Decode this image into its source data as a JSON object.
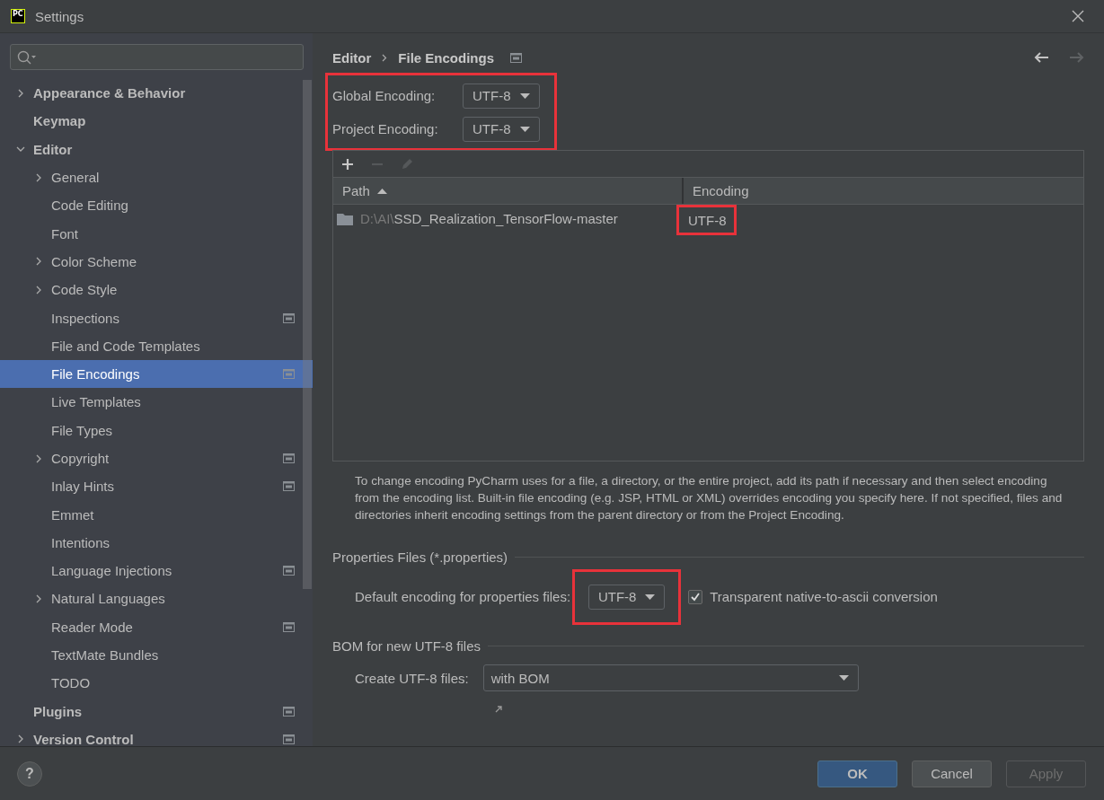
{
  "window": {
    "title": "Settings",
    "logo_text": "PC"
  },
  "sidebar": {
    "items": [
      {
        "label": "Appearance & Behavior",
        "expanded": false,
        "selected": false
      },
      {
        "label": "Keymap",
        "selected": false
      },
      {
        "label": "Editor",
        "expanded": true,
        "selected": false,
        "children": [
          {
            "label": "General",
            "expanded": false,
            "selected": false
          },
          {
            "label": "Code Editing",
            "selected": false
          },
          {
            "label": "Font",
            "selected": false
          },
          {
            "label": "Color Scheme",
            "expanded": false,
            "selected": false
          },
          {
            "label": "Code Style",
            "expanded": false,
            "selected": false
          },
          {
            "label": "Inspections",
            "selected": false,
            "project_scoped": true
          },
          {
            "label": "File and Code Templates",
            "selected": false
          },
          {
            "label": "File Encodings",
            "selected": true,
            "project_scoped": true
          },
          {
            "label": "Live Templates",
            "selected": false
          },
          {
            "label": "File Types",
            "selected": false
          },
          {
            "label": "Copyright",
            "expanded": false,
            "selected": false,
            "project_scoped": true
          },
          {
            "label": "Inlay Hints",
            "selected": false,
            "project_scoped": true
          },
          {
            "label": "Emmet",
            "selected": false
          },
          {
            "label": "Intentions",
            "selected": false
          },
          {
            "label": "Language Injections",
            "selected": false,
            "project_scoped": true
          },
          {
            "label": "Natural Languages",
            "expanded": false,
            "selected": false
          },
          {
            "label": "Reader Mode",
            "selected": false,
            "project_scoped": true
          },
          {
            "label": "TextMate Bundles",
            "selected": false
          },
          {
            "label": "TODO",
            "selected": false
          }
        ]
      },
      {
        "label": "Plugins",
        "selected": false,
        "project_scoped": true
      },
      {
        "label": "Version Control",
        "expanded": false,
        "selected": false,
        "project_scoped": true
      }
    ]
  },
  "header": {
    "breadcrumb": [
      "Editor",
      "File Encodings"
    ],
    "project_scoped": true,
    "navigation": [
      {
        "kind": "back",
        "disabled": false
      },
      {
        "kind": "forward",
        "disabled": true
      }
    ]
  },
  "encodings": {
    "highlighted": true,
    "fields": [
      {
        "label": "Global Encoding:",
        "value": "UTF-8"
      },
      {
        "label": "Project Encoding:",
        "value": "UTF-8"
      }
    ]
  },
  "table": {
    "toolbar": [
      {
        "kind": "add",
        "disabled": false
      },
      {
        "kind": "remove",
        "disabled": true
      },
      {
        "kind": "edit",
        "disabled": true
      }
    ],
    "columns": [
      {
        "label": "Path",
        "sort_ascending": true
      },
      {
        "label": "Encoding"
      }
    ],
    "rows": [
      {
        "path_prefix": "D:\\AI\\",
        "path": "SSD_Realization_TensorFlow-master",
        "encoding": "UTF-8",
        "highlighted": true
      }
    ]
  },
  "help_text": "To change encoding PyCharm uses for a file, a directory, or the entire project, add its path if necessary and then select encoding from the encoding list. Built-in file encoding (e.g. JSP, HTML or XML) overrides encoding you specify here. If not specified, files and directories inherit encoding settings from the parent directory or from the Project Encoding.",
  "properties": {
    "title": "Properties Files (*.properties)",
    "label": "Default encoding for properties files:",
    "value": "UTF-8",
    "highlighted": true,
    "checkbox": {
      "label": "Transparent native-to-ascii conversion",
      "checked": true
    }
  },
  "bom": {
    "title": "BOM for new UTF-8 files",
    "label": "Create UTF-8 files:",
    "value": "with BOM"
  },
  "footer": {
    "help": "?",
    "buttons": [
      {
        "label": "OK",
        "kind": "primary",
        "disabled": false
      },
      {
        "label": "Cancel",
        "kind": "normal",
        "disabled": false
      },
      {
        "label": "Apply",
        "kind": "normal",
        "disabled": true
      }
    ]
  }
}
